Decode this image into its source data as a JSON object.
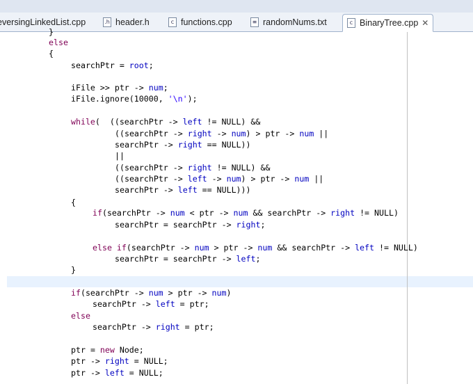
{
  "tabs": [
    {
      "label": "eversingLinkedList.cpp"
    },
    {
      "label": "header.h"
    },
    {
      "label": "functions.cpp"
    },
    {
      "label": "randomNums.txt"
    },
    {
      "label": "BinaryTree.cpp",
      "active": true
    }
  ],
  "editor": {
    "lines": [
      "}",
      "else",
      "{",
      "searchPtr = root;",
      "iFile >> ptr -> num;",
      "iFile.ignore(10000, '\\n');",
      "while(  ((searchPtr -> left != NULL) &&",
      "((searchPtr -> right -> num) > ptr -> num ||",
      "searchPtr -> right == NULL))",
      "||",
      "((searchPtr -> right != NULL) &&",
      "((searchPtr -> left -> num) > ptr -> num ||",
      "searchPtr -> left == NULL)))",
      "{",
      "if(searchPtr -> num < ptr -> num && searchPtr -> right != NULL)",
      "searchPtr = searchPtr -> right;",
      "else if(searchPtr -> num > ptr -> num && searchPtr -> left != NULL)",
      "searchPtr = searchPtr -> left;",
      "}",
      "if(searchPtr -> num > ptr -> num)",
      "searchPtr -> left = ptr;",
      "else",
      "searchPtr -> right = ptr;",
      "ptr = new Node;",
      "ptr -> right = NULL;",
      "ptr -> left = NULL;"
    ]
  }
}
